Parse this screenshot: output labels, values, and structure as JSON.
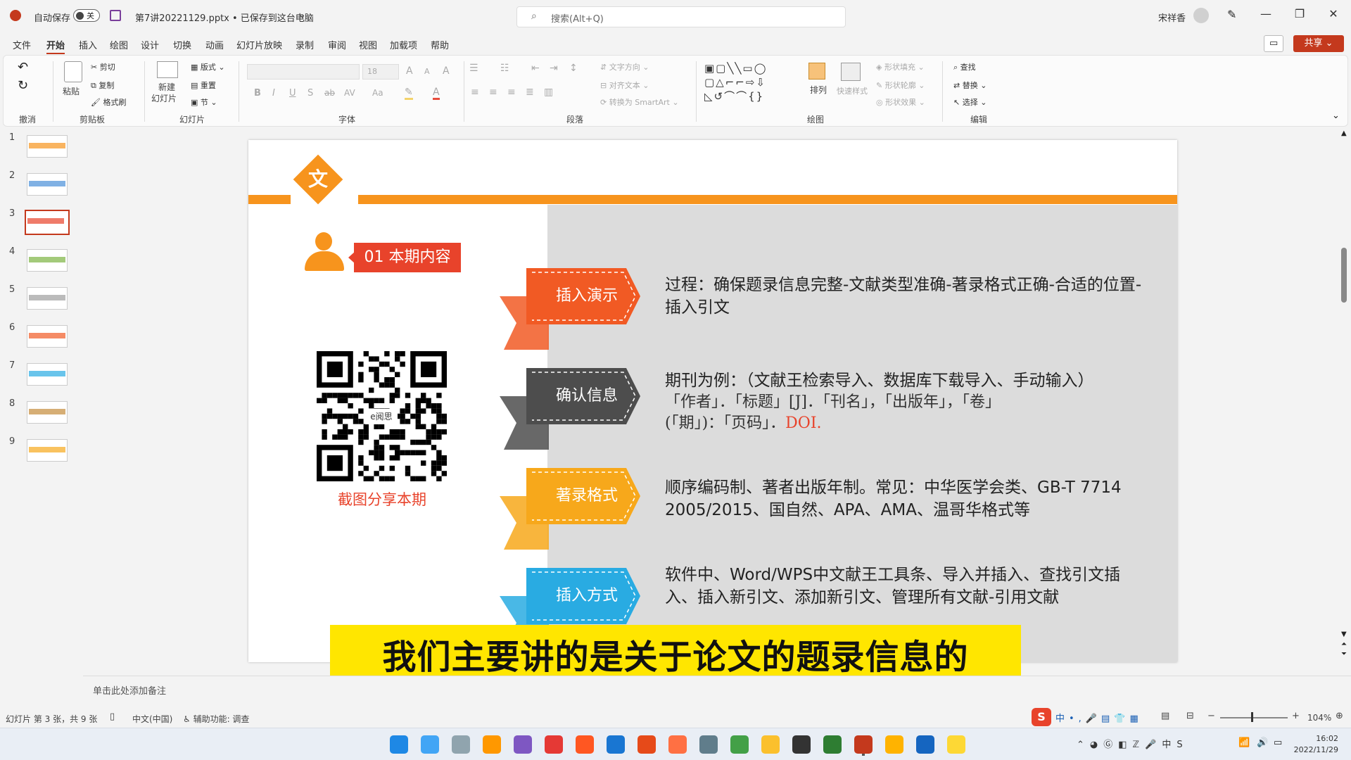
{
  "app": {
    "autosave_label": "自动保存",
    "autosave_state": "关",
    "doc_title": "第7讲20221129.pptx • 已保存到这台电脑",
    "search_placeholder": "搜索(Alt+Q)",
    "user_name": "宋祥香"
  },
  "menu": [
    "文件",
    "开始",
    "插入",
    "绘图",
    "设计",
    "切换",
    "动画",
    "幻灯片放映",
    "录制",
    "审阅",
    "视图",
    "加载项",
    "帮助"
  ],
  "menu_active": "开始",
  "share_label": "共享",
  "ribbon": {
    "undo_group": "撤消",
    "clipboard": {
      "paste": "粘贴",
      "cut": "剪切",
      "copy": "复制",
      "format_painter": "格式刷",
      "label": "剪贴板"
    },
    "slides": {
      "new_slide_1": "新建",
      "new_slide_2": "幻灯片",
      "layout": "版式",
      "reset": "重置",
      "section": "节",
      "label": "幻灯片"
    },
    "font": {
      "size": "18",
      "label": "字体",
      "bold": "B",
      "italic": "I",
      "underline": "U",
      "shadow": "S",
      "strike": "ab",
      "spacing": "AV",
      "case": "Aa",
      "grow": "A",
      "shrink": "A",
      "clear": "A"
    },
    "paragraph": {
      "text_direction": "文字方向",
      "align_text": "对齐文本",
      "smartart": "转换为 SmartArt",
      "label": "段落"
    },
    "drawing": {
      "arrange": "排列",
      "quick_styles": "快速样式",
      "shape_fill": "形状填充",
      "shape_outline": "形状轮廓",
      "shape_effects": "形状效果",
      "label": "绘图"
    },
    "editing": {
      "find": "查找",
      "replace": "替换",
      "select": "选择",
      "label": "编辑"
    }
  },
  "thumbnails": [
    "1",
    "2",
    "3",
    "4",
    "5",
    "6",
    "7",
    "8",
    "9"
  ],
  "selected_slide": 3,
  "slide": {
    "logo_char": "文",
    "period_tag": "01 本期内容",
    "qr_inner": "e阅思",
    "qr_caption": "截图分享本期",
    "items": [
      {
        "tag": "插入演示",
        "color": "#f15a24",
        "text": "过程：确保题录信息完整-文献类型准确-著录格式正确-合适的位置-插入引文"
      },
      {
        "tag": "确认信息",
        "color": "#4d4d4d",
        "text": "期刊为例：（文献王检索导入、数据库下载导入、手动输入）",
        "ref_line1": "「作者」．「标题」[J]．「刊名」，「出版年」，「卷」",
        "ref_line2": "(「期」)：「页码」．",
        "ref_doi": "DOI."
      },
      {
        "tag": "著录格式",
        "color": "#f7a81b",
        "text": "顺序编码制、著者出版年制。常见：中华医学会类、GB-T 7714 2005/2015、国自然、APA、AMA、温哥华格式等"
      },
      {
        "tag": "插入方式",
        "color": "#29abe2",
        "text": "软件中、Word/WPS中文献王工具条、导入并插入、查找引文插入、插入新引文、添加新引文、管理所有文献-引用文献"
      }
    ]
  },
  "subtitle": "我们主要讲的是关于论文的题录信息的",
  "notes_placeholder": "单击此处添加备注",
  "status": {
    "slide_of": "幻灯片 第 3 张，共 9 张",
    "language": "中文(中国)",
    "accessibility": "辅助功能: 调查",
    "zoom": "104%"
  },
  "tray": {
    "time": "16:02",
    "date": "2022/11/29",
    "ime": "中"
  },
  "taskbar_icons": [
    "windows-start",
    "monitor",
    "photos",
    "search",
    "rp",
    "x-app",
    "pdf",
    "teams",
    "g-app",
    "diamond-app",
    "notepad",
    "chrome",
    "folder",
    "penguin",
    "wechat",
    "powerpoint",
    "paint",
    "p-app",
    "sticky"
  ]
}
